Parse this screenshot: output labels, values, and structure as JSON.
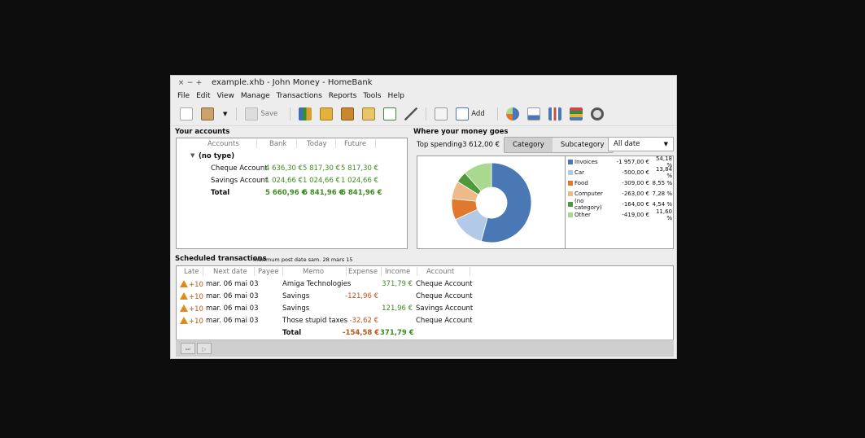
{
  "window": {
    "title": "example.xhb - John Money - HomeBank",
    "controls": [
      "×",
      "−",
      "+"
    ]
  },
  "menu": [
    "File",
    "Edit",
    "View",
    "Manage",
    "Transactions",
    "Reports",
    "Tools",
    "Help"
  ],
  "toolbar": {
    "save_label": "Save",
    "add_label": "Add"
  },
  "accounts": {
    "title": "Your accounts",
    "headers": [
      "Accounts",
      "Bank",
      "Today",
      "Future"
    ],
    "group": "(no type)",
    "rows": [
      {
        "name": "Cheque Account",
        "bank": "4 636,30 €",
        "today": "5 817,30 €",
        "future": "5 817,30 €"
      },
      {
        "name": "Savings Account",
        "bank": "1 024,66 €",
        "today": "1 024,66 €",
        "future": "1 024,66 €"
      }
    ],
    "total": {
      "name": "Total",
      "bank": "5 660,96 €",
      "today": "6 841,96 €",
      "future": "6 841,96 €"
    }
  },
  "spending": {
    "title": "Where your money goes",
    "top_label": "Top spending",
    "top_value": "-3 612,00 €",
    "tabs": [
      "Category",
      "Subcategory"
    ],
    "range": "All date",
    "colors": {
      "invoices": "#4a78b5",
      "car": "#b3c9e8",
      "food": "#e0782d",
      "computer": "#f0b98a",
      "nocat": "#4e9a3a",
      "other": "#a9d98e"
    }
  },
  "chart_data": {
    "type": "pie",
    "categories": [
      "Invoices",
      "Car",
      "Food",
      "Computer",
      "(no category)",
      "Other"
    ],
    "values": [
      -1957.0,
      -500.0,
      -309.0,
      -263.0,
      -164.0,
      -419.0
    ],
    "amounts": [
      "-1 957,00 €",
      "-500,00 €",
      "-309,00 €",
      "-263,00 €",
      "-164,00 €",
      "-419,00 €"
    ],
    "percents": [
      "54,18 %",
      "13,84 %",
      "8,55 %",
      "7,28 %",
      "4,54 %",
      "11,60 %"
    ],
    "legend": "right"
  },
  "scheduled": {
    "title": "Scheduled transactions",
    "subtitle": "maximum post date  sam. 28 mars 15",
    "headers": [
      "Late",
      "Next date",
      "Payee",
      "Memo",
      "Expense",
      "Income",
      "Account"
    ],
    "rows": [
      {
        "late": "+10",
        "date": "mar. 06 mai 03",
        "memo": "Amiga Technologies",
        "expense": "",
        "income": "371,79 €",
        "account": "Cheque Account"
      },
      {
        "late": "+10",
        "date": "mar. 06 mai 03",
        "memo": "Savings",
        "expense": "-121,96 €",
        "income": "",
        "account": "Cheque Account"
      },
      {
        "late": "+10",
        "date": "mar. 06 mai 03",
        "memo": "Savings",
        "expense": "",
        "income": "121,96 €",
        "account": "Savings Account"
      },
      {
        "late": "+10",
        "date": "mar. 06 mai 03",
        "memo": "Those stupid taxes",
        "expense": "-32,62 €",
        "income": "",
        "account": "Cheque Account"
      }
    ],
    "total": {
      "label": "Total",
      "expense": "-154,58 €",
      "income": "371,79 €"
    }
  }
}
